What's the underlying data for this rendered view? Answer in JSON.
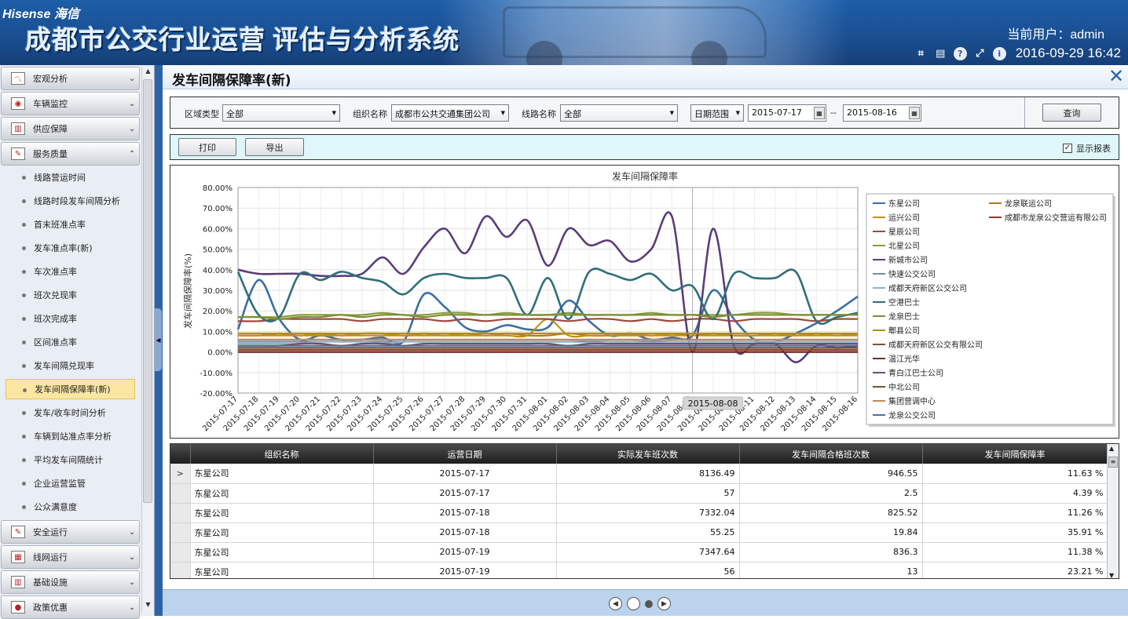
{
  "header": {
    "brand": "Hisense 海信",
    "system_title": "成都市公交行业运营 评估与分析系统",
    "user_label": "当前用户：admin",
    "datetime": "2016-09-29 16:42",
    "icons": [
      "crop-icon",
      "keyboard-icon",
      "help-icon",
      "fullscreen-icon",
      "info-icon"
    ]
  },
  "sidebar": {
    "groups": [
      {
        "label": "宏观分析",
        "icon": "chart-icon",
        "expanded": false
      },
      {
        "label": "车辆监控",
        "icon": "camera-icon",
        "expanded": false
      },
      {
        "label": "供应保障",
        "icon": "supply-icon",
        "expanded": false
      },
      {
        "label": "服务质量",
        "icon": "quality-icon",
        "expanded": true
      },
      {
        "label": "安全运行",
        "icon": "safety-icon",
        "expanded": false
      },
      {
        "label": "线网运行",
        "icon": "network-icon",
        "expanded": false
      },
      {
        "label": "基础设施",
        "icon": "infrastructure-icon",
        "expanded": false
      },
      {
        "label": "政策优惠",
        "icon": "policy-icon",
        "expanded": false
      }
    ],
    "sub_items": [
      "线路营运时间",
      "线路时段发车间隔分析",
      "首末班准点率",
      "发车准点率(新)",
      "车次准点率",
      "班次兑现率",
      "班次完成率",
      "区间准点率",
      "发车间隔兑现率",
      "发车间隔保障率(新)",
      "发车/收车时间分析",
      "车辆到站准点率分析",
      "平均发车间隔统计",
      "企业运营监管",
      "公众满意度"
    ],
    "active_item": "发车间隔保障率(新)"
  },
  "page": {
    "title": "发车间隔保障率(新)",
    "close_icon": "close-icon"
  },
  "filter": {
    "area_type_label": "区域类型",
    "area_type_value": "全部",
    "org_label": "组织名称",
    "org_value": "成都市公共交通集团公司",
    "line_label": "线路名称",
    "line_value": "全部",
    "date_mode": "日期范围",
    "date_from": "2015-07-17",
    "date_sep": "--",
    "date_to": "2015-08-16",
    "query_button": "查询"
  },
  "actions": {
    "print_button": "打印",
    "export_button": "导出",
    "show_report_label": "显示报表",
    "show_report_checked": true
  },
  "chart_data": {
    "type": "line",
    "title": "发车间隔保障率",
    "ylabel": "发车间隔保障率(%)",
    "xlabel": "",
    "ylim": [
      -20,
      80
    ],
    "yticks": [
      "80.00%",
      "70.00%",
      "60.00%",
      "50.00%",
      "40.00%",
      "30.00%",
      "20.00%",
      "10.00%",
      "0.00%",
      "-10.00%",
      "-20.00%"
    ],
    "categories": [
      "2015-07-17",
      "2015-07-18",
      "2015-07-19",
      "2015-07-20",
      "2015-07-21",
      "2015-07-22",
      "2015-07-23",
      "2015-07-24",
      "2015-07-25",
      "2015-07-26",
      "2015-07-27",
      "2015-07-28",
      "2015-07-29",
      "2015-07-30",
      "2015-07-31",
      "2015-08-01",
      "2015-08-02",
      "2015-08-03",
      "2015-08-04",
      "2015-08-05",
      "2015-08-06",
      "2015-08-07",
      "2015-08-08",
      "2015-08-09",
      "2015-08-10",
      "2015-08-11",
      "2015-08-12",
      "2015-08-13",
      "2015-08-14",
      "2015-08-15",
      "2015-08-16"
    ],
    "crosshair_label": "2015-08-08",
    "crosshair_index": 22,
    "grid": true,
    "legend_position": "right",
    "series": [
      {
        "name": "东星公司",
        "color": "#3b6ea5",
        "values": [
          11,
          35,
          16,
          6,
          8,
          6,
          6,
          7,
          5,
          28,
          22,
          12,
          10,
          13,
          11,
          12,
          25,
          15,
          8,
          9,
          6,
          7,
          8,
          30,
          16,
          6,
          5,
          9,
          14,
          20,
          27
        ]
      },
      {
        "name": "龙泉联运公司",
        "color": "#b5742e",
        "values": [
          8,
          8,
          9,
          8,
          9,
          8,
          9,
          9,
          8,
          9,
          8,
          9,
          8,
          9,
          8,
          8,
          9,
          8,
          8,
          9,
          8,
          9,
          8,
          9,
          8,
          8,
          9,
          8,
          9,
          8,
          9
        ]
      },
      {
        "name": "运兴公司",
        "color": "#c0901c",
        "values": [
          8,
          8,
          8,
          8,
          8,
          8,
          8,
          8,
          8,
          8,
          8,
          8,
          8,
          8,
          8,
          16,
          8,
          8,
          8,
          8,
          8,
          8,
          8,
          8,
          8,
          8,
          8,
          8,
          8,
          8,
          8
        ]
      },
      {
        "name": "成都市龙泉公交营运有限公司",
        "color": "#8e3b2f",
        "values": [
          0,
          0,
          0,
          0,
          0,
          0,
          0,
          0,
          0,
          0,
          0,
          0,
          0,
          0,
          0,
          0,
          0,
          0,
          0,
          0,
          0,
          0,
          0,
          0,
          0,
          0,
          0,
          0,
          0,
          0,
          0
        ]
      },
      {
        "name": "星辰公司",
        "color": "#a0463a",
        "values": [
          15,
          15,
          16,
          16,
          16,
          16,
          15,
          16,
          16,
          16,
          15,
          16,
          15,
          16,
          16,
          16,
          15,
          16,
          16,
          15,
          16,
          15,
          16,
          16,
          15,
          16,
          16,
          16,
          15,
          16,
          16
        ]
      },
      {
        "name": "北星公司",
        "color": "#8a9a3c",
        "values": [
          17,
          17,
          17,
          18,
          18,
          18,
          18,
          19,
          18,
          18,
          19,
          19,
          18,
          19,
          18,
          18,
          19,
          18,
          18,
          18,
          19,
          18,
          18,
          18,
          18,
          19,
          19,
          18,
          18,
          18,
          18
        ]
      },
      {
        "name": "新城市公司",
        "color": "#5a3d7a",
        "values": [
          40,
          38,
          38,
          38,
          37,
          37,
          38,
          46,
          38,
          51,
          60,
          48,
          66,
          56,
          64,
          42,
          60,
          52,
          54,
          44,
          50,
          66,
          0,
          60,
          3,
          4,
          4,
          -5,
          3,
          2,
          3
        ]
      },
      {
        "name": "快速公交公司",
        "color": "#6a8fb5",
        "values": [
          5,
          5,
          5,
          5,
          5,
          5,
          5,
          5,
          5,
          5,
          5,
          5,
          5,
          5,
          5,
          5,
          5,
          5,
          5,
          5,
          5,
          5,
          5,
          5,
          5,
          5,
          5,
          5,
          5,
          5,
          5
        ]
      },
      {
        "name": "成都天府新区公交公司",
        "color": "#8fb2c9",
        "values": [
          4,
          4,
          4,
          4,
          5,
          5,
          5,
          4,
          5,
          5,
          5,
          5,
          5,
          5,
          5,
          5,
          5,
          6,
          5,
          5,
          6,
          5,
          5,
          5,
          5,
          5,
          5,
          5,
          5,
          5,
          5
        ]
      },
      {
        "name": "空港巴士",
        "color": "#2f6f7a",
        "values": [
          39,
          18,
          17,
          38,
          35,
          39,
          36,
          34,
          28,
          36,
          38,
          36,
          36,
          36,
          18,
          36,
          16,
          39,
          38,
          35,
          38,
          30,
          32,
          16,
          38,
          36,
          36,
          39,
          15,
          17,
          19
        ]
      },
      {
        "name": "龙泉巴士",
        "color": "#7c8f34",
        "values": [
          17,
          17,
          16,
          17,
          17,
          18,
          17,
          18,
          18,
          17,
          18,
          18,
          18,
          18,
          18,
          18,
          18,
          18,
          18,
          18,
          18,
          18,
          18,
          17,
          18,
          18,
          18,
          18,
          18,
          18,
          18
        ]
      },
      {
        "name": "郫县公司",
        "color": "#b0901c",
        "values": [
          9,
          9,
          9,
          9,
          9,
          9,
          9,
          9,
          9,
          9,
          9,
          9,
          9,
          9,
          9,
          9,
          9,
          9,
          9,
          9,
          9,
          9,
          9,
          9,
          9,
          9,
          9,
          9,
          9,
          9,
          9
        ]
      },
      {
        "name": "成都天府新区公交有限公司",
        "color": "#8a4a3a",
        "values": [
          1,
          1,
          1,
          1,
          1,
          1,
          1,
          1,
          1,
          1,
          1,
          1,
          1,
          1,
          1,
          1,
          1,
          1,
          1,
          1,
          1,
          1,
          1,
          1,
          1,
          1,
          1,
          1,
          1,
          1,
          1
        ]
      },
      {
        "name": "温江光华",
        "color": "#7a2a2a",
        "values": [
          0,
          0,
          0,
          0,
          0,
          0,
          0,
          0,
          0,
          0,
          0,
          0,
          0,
          0,
          0,
          0,
          0,
          0,
          0,
          0,
          0,
          0,
          0,
          0,
          0,
          0,
          0,
          0,
          0,
          0,
          0
        ]
      },
      {
        "name": "青白江巴士公司",
        "color": "#6a4f7a",
        "values": [
          3,
          3,
          3,
          4,
          4,
          3,
          4,
          4,
          3,
          4,
          4,
          4,
          4,
          4,
          4,
          4,
          3,
          4,
          4,
          4,
          4,
          4,
          4,
          4,
          4,
          4,
          4,
          4,
          4,
          4,
          4
        ]
      },
      {
        "name": "中北公司",
        "color": "#7a5030",
        "values": [
          2,
          2,
          2,
          2,
          2,
          2,
          2,
          2,
          2,
          2,
          2,
          2,
          2,
          2,
          2,
          2,
          2,
          2,
          2,
          2,
          2,
          2,
          2,
          2,
          2,
          2,
          2,
          2,
          2,
          2,
          2
        ]
      },
      {
        "name": "集团营调中心",
        "color": "#c08a5a",
        "values": [
          6,
          6,
          6,
          6,
          6,
          6,
          6,
          6,
          6,
          6,
          6,
          6,
          6,
          6,
          6,
          6,
          6,
          6,
          6,
          6,
          6,
          6,
          6,
          6,
          6,
          6,
          6,
          6,
          6,
          6,
          6
        ]
      },
      {
        "name": "龙泉公交公司",
        "color": "#4a6fa0",
        "values": [
          3,
          3,
          3,
          3,
          3,
          3,
          3,
          3,
          3,
          3,
          3,
          3,
          3,
          3,
          3,
          3,
          3,
          3,
          3,
          3,
          3,
          3,
          3,
          3,
          3,
          3,
          3,
          3,
          3,
          3,
          3
        ]
      }
    ]
  },
  "table": {
    "columns": [
      "组织名称",
      "运营日期",
      "实际发车班次数",
      "发车间隔合格班次数",
      "发车间隔保障率"
    ],
    "rows": [
      {
        "marker": ">",
        "org": "东星公司",
        "date": "2015-07-17",
        "actual": "8136.49",
        "qualified": "946.55",
        "rate": "11.63 %"
      },
      {
        "marker": "",
        "org": "东星公司",
        "date": "2015-07-17",
        "actual": "57",
        "qualified": "2.5",
        "rate": "4.39 %"
      },
      {
        "marker": "",
        "org": "东星公司",
        "date": "2015-07-18",
        "actual": "7332.04",
        "qualified": "825.52",
        "rate": "11.26 %"
      },
      {
        "marker": "",
        "org": "东星公司",
        "date": "2015-07-18",
        "actual": "55.25",
        "qualified": "19.84",
        "rate": "35.91 %"
      },
      {
        "marker": "",
        "org": "东星公司",
        "date": "2015-07-19",
        "actual": "7347.64",
        "qualified": "836.3",
        "rate": "11.38 %"
      },
      {
        "marker": "",
        "org": "东星公司",
        "date": "2015-07-19",
        "actual": "56",
        "qualified": "13",
        "rate": "23.21 %"
      }
    ]
  },
  "pager": {
    "icons": [
      "prev-page-icon",
      "page-dot-icon",
      "page-dot-active-icon",
      "next-page-icon"
    ]
  }
}
